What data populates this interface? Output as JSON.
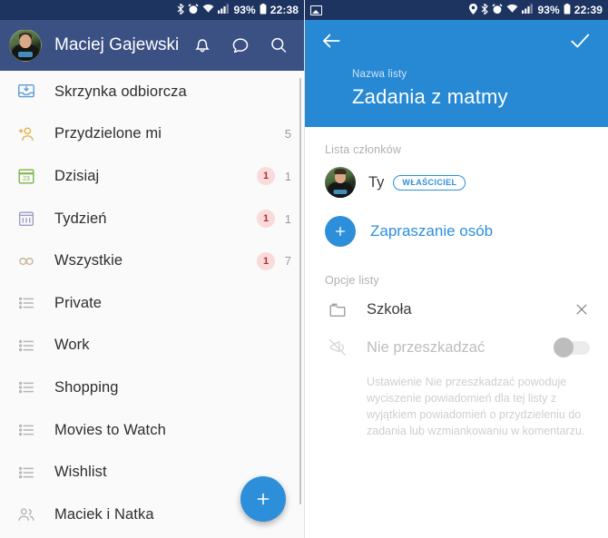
{
  "left": {
    "statusbar": {
      "icons": [
        "bluetooth-icon",
        "alarm-icon",
        "wifi-icon",
        "signal-icon"
      ],
      "battery": "93%",
      "time": "22:38"
    },
    "appbar": {
      "title": "Maciej Gajewski",
      "avatar_name": "user-avatar",
      "actions": [
        "notifications-bell-icon",
        "chat-bubble-icon",
        "search-icon"
      ]
    },
    "nav_items": [
      {
        "icon": "inbox-icon",
        "label": "Skrzynka odbiorcza",
        "badge": "",
        "count": ""
      },
      {
        "icon": "assigned-icon",
        "label": "Przydzielone mi",
        "badge": "",
        "count": "5"
      },
      {
        "icon": "calendar-icon",
        "label": "Dzisiaj",
        "badge": "1",
        "count": "1"
      },
      {
        "icon": "week-icon",
        "label": "Tydzień",
        "badge": "1",
        "count": "1"
      },
      {
        "icon": "infinity-icon",
        "label": "Wszystkie",
        "badge": "1",
        "count": "7"
      },
      {
        "icon": "list-icon",
        "label": "Private",
        "badge": "",
        "count": ""
      },
      {
        "icon": "list-icon",
        "label": "Work",
        "badge": "",
        "count": ""
      },
      {
        "icon": "list-icon",
        "label": "Shopping",
        "badge": "",
        "count": ""
      },
      {
        "icon": "list-icon",
        "label": "Movies to Watch",
        "badge": "",
        "count": ""
      },
      {
        "icon": "list-icon",
        "label": "Wishlist",
        "badge": "",
        "count": ""
      },
      {
        "icon": "people-icon",
        "label": "Maciek i Natka",
        "badge": "",
        "count": ""
      }
    ],
    "fab": {
      "name": "add-button",
      "glyph": "+"
    },
    "colors": {
      "appbar": "#3b5083",
      "statusbar": "#1d3461",
      "accent": "#2d8fda",
      "badge_bg": "#fadbdb",
      "badge_text": "#b03030"
    }
  },
  "right": {
    "statusbar": {
      "left_icons": [
        "screenshot-image-icon"
      ],
      "icons": [
        "location-icon",
        "bluetooth-icon",
        "alarm-icon",
        "wifi-icon",
        "signal-icon"
      ],
      "battery": "93%",
      "time": "22:39"
    },
    "hero": {
      "back": "back-arrow-icon",
      "confirm": "checkmark-icon",
      "field_label": "Nazwa listy",
      "list_name": "Zadania z matmy",
      "bg_color": "#2789d4"
    },
    "members": {
      "section_label": "Lista członków",
      "member_name": "Ty",
      "owner_badge": "WŁAŚCICIEL",
      "invite_label": "Zapraszanie osób",
      "invite_glyph": "+"
    },
    "options": {
      "section_label": "Opcje listy",
      "folder_label": "Szkoła",
      "dnd_label": "Nie przeszkadzać",
      "dnd_enabled": false,
      "dnd_description": "Ustawienie Nie przeszkadzać powoduje wyciszenie powiadomień dla tej listy z wyjątkiem powiadomień o przydzieleniu do zadania lub wzmiankowaniu w komentarzu."
    }
  }
}
